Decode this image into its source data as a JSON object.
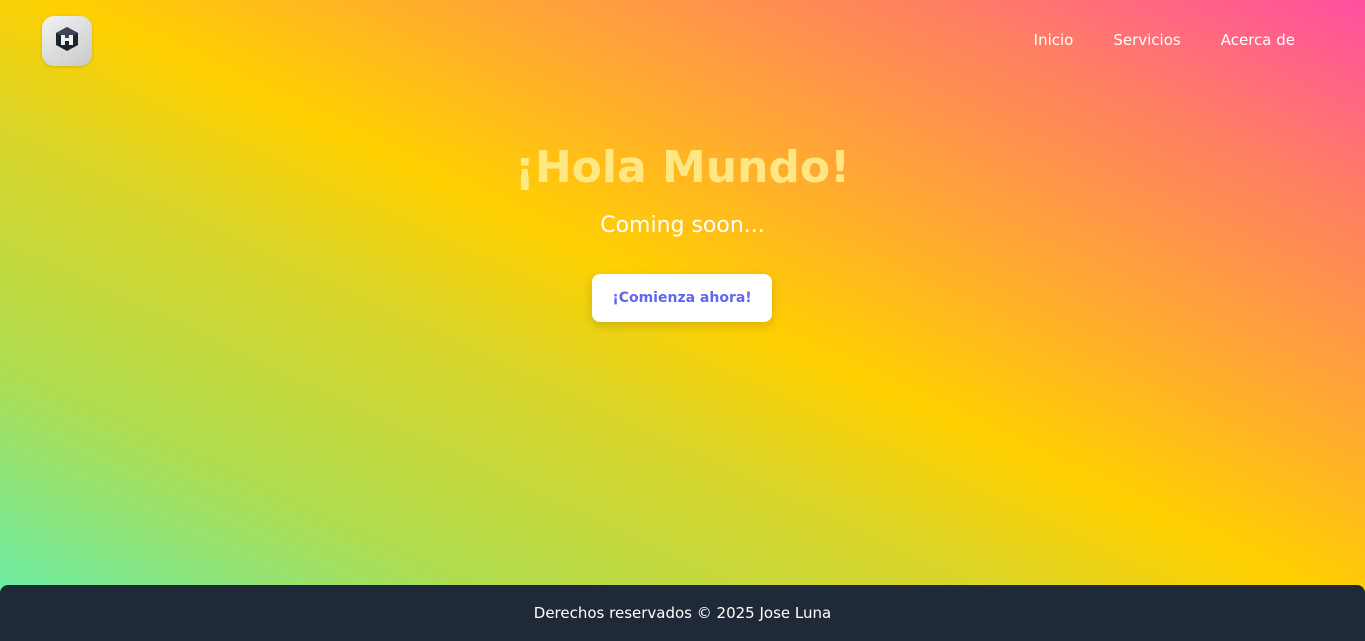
{
  "header": {
    "logo_icon": "cube-logo-icon",
    "nav": [
      {
        "label": "Inicio"
      },
      {
        "label": "Servicios"
      },
      {
        "label": "Acerca de"
      }
    ]
  },
  "hero": {
    "title": "¡Hola Mundo!",
    "subtitle": "Coming soon...",
    "cta_label": "¡Comienza ahora!"
  },
  "footer": {
    "text": "Derechos reservados © 2025 Jose Luna"
  },
  "colors": {
    "gradient": [
      "#5ef0b8",
      "#b0dc4e",
      "#ffd000",
      "#ffa636",
      "#ff4fa1"
    ],
    "button_text": "#6366f1",
    "footer_bg": "#1f2937"
  }
}
